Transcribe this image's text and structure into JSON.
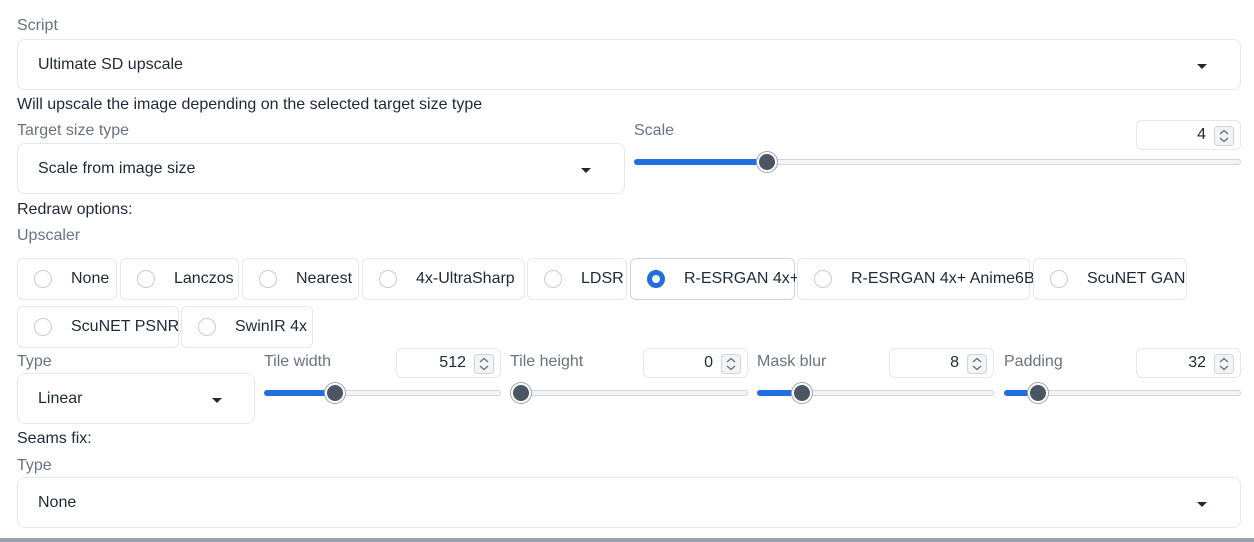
{
  "script": {
    "label": "Script",
    "value": "Ultimate SD upscale"
  },
  "info_text": "Will upscale the image depending on the selected target size type",
  "target_size": {
    "label": "Target size type",
    "value": "Scale from image size"
  },
  "scale": {
    "label": "Scale",
    "value": "4",
    "fraction": 0.21
  },
  "redraw_title": "Redraw options:",
  "upscaler": {
    "label": "Upscaler",
    "options": [
      "None",
      "Lanczos",
      "Nearest",
      "4x-UltraSharp",
      "LDSR",
      "R-ESRGAN 4x+",
      "R-ESRGAN 4x+ Anime6B",
      "ScuNET GAN",
      "ScuNET PSNR",
      "SwinIR 4x"
    ],
    "selected": "R-ESRGAN 4x+"
  },
  "redraw_type": {
    "label": "Type",
    "value": "Linear"
  },
  "tile_width": {
    "label": "Tile width",
    "value": "512",
    "fraction": 0.28
  },
  "tile_height": {
    "label": "Tile height",
    "value": "0",
    "fraction": 0.0
  },
  "mask_blur": {
    "label": "Mask blur",
    "value": "8",
    "fraction": 0.16
  },
  "padding": {
    "label": "Padding",
    "value": "32",
    "fraction": 0.11
  },
  "seams_title": "Seams fix:",
  "seams_type": {
    "label": "Type",
    "value": "None"
  },
  "colors": {
    "accent": "#1f6fe0",
    "thumb": "#4b5563",
    "border": "#e5e7eb"
  }
}
